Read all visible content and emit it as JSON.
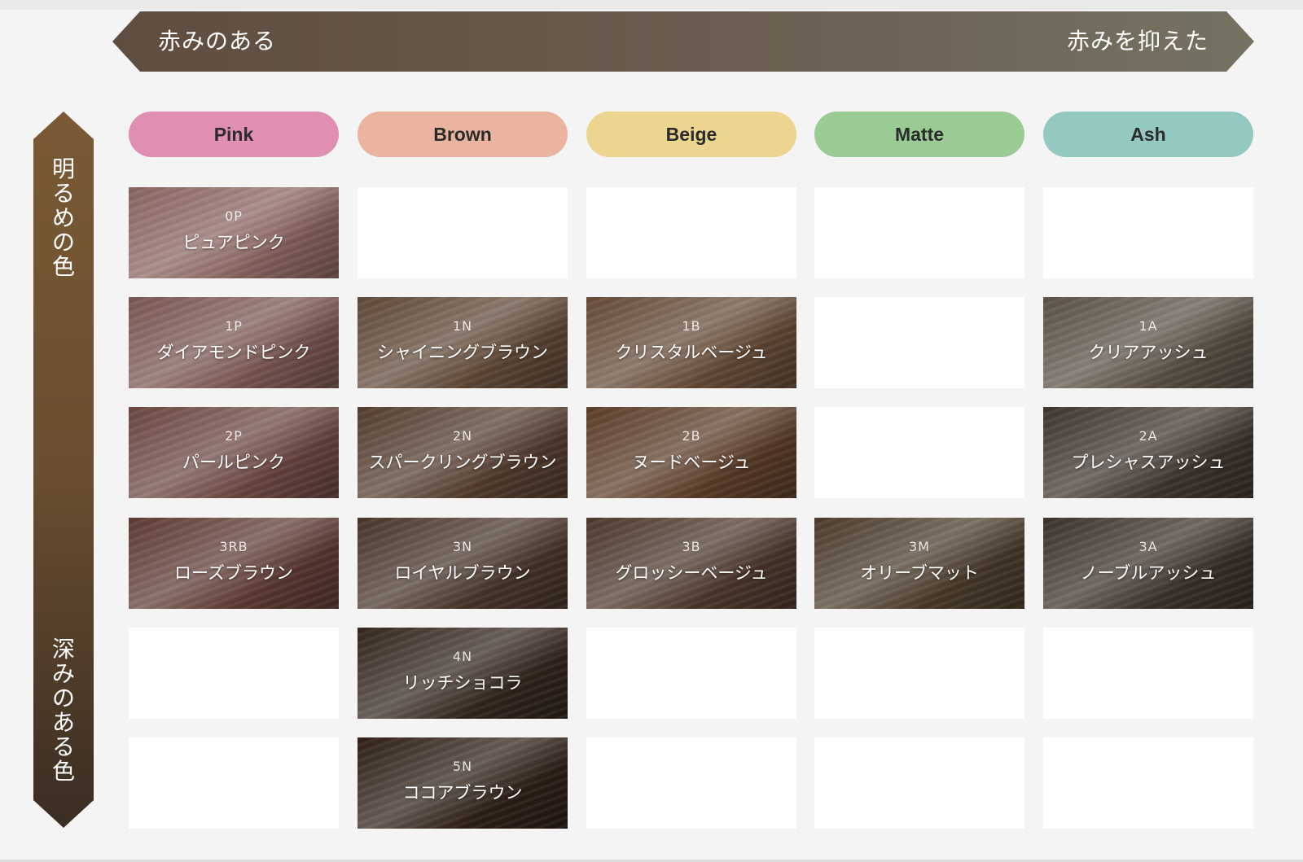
{
  "top_axis": {
    "left_label": "赤みのある",
    "right_label": "赤みを抑えた"
  },
  "side_axis": {
    "top_label": "明るめの色",
    "bottom_label": "深みのある色"
  },
  "columns": [
    {
      "label": "Pink",
      "color": "#e08fb3"
    },
    {
      "label": "Brown",
      "color": "#ebb4a0"
    },
    {
      "label": "Beige",
      "color": "#ebd58f"
    },
    {
      "label": "Matte",
      "color": "#9bcb95"
    },
    {
      "label": "Ash",
      "color": "#93c9c0"
    }
  ],
  "rows": [
    [
      {
        "code": "0P",
        "name": "ピュアピンク",
        "color": "#8a6460"
      },
      null,
      null,
      null,
      null
    ],
    [
      {
        "code": "1P",
        "name": "ダイアモンドピンク",
        "color": "#7a5651"
      },
      {
        "code": "1N",
        "name": "シャイニングブラウン",
        "color": "#5f4735"
      },
      {
        "code": "1B",
        "name": "クリスタルベージュ",
        "color": "#654a36"
      },
      null,
      {
        "code": "1A",
        "name": "クリアアッシュ",
        "color": "#5a5045"
      }
    ],
    [
      {
        "code": "2P",
        "name": "パールピンク",
        "color": "#6b4641"
      },
      {
        "code": "2N",
        "name": "スパークリングブラウン",
        "color": "#533c2d"
      },
      {
        "code": "2B",
        "name": "ヌードベージュ",
        "color": "#5b3c27"
      },
      null,
      {
        "code": "2A",
        "name": "プレシャスアッシュ",
        "color": "#3e342d"
      }
    ],
    [
      {
        "code": "3RB",
        "name": "ローズブラウン",
        "color": "#5e3a33"
      },
      {
        "code": "3N",
        "name": "ロイヤルブラウン",
        "color": "#47342a"
      },
      {
        "code": "3B",
        "name": "グロッシーベージュ",
        "color": "#4c372b"
      },
      {
        "code": "3M",
        "name": "オリーブマット",
        "color": "#4a3b2a"
      },
      {
        "code": "3A",
        "name": "ノーブルアッシュ",
        "color": "#3b3129"
      }
    ],
    [
      null,
      {
        "code": "4N",
        "name": "リッチショコラ",
        "color": "#33251d"
      },
      null,
      null,
      null
    ],
    [
      null,
      {
        "code": "5N",
        "name": "ココアブラウン",
        "color": "#2e1f17"
      },
      null,
      null,
      null
    ]
  ]
}
